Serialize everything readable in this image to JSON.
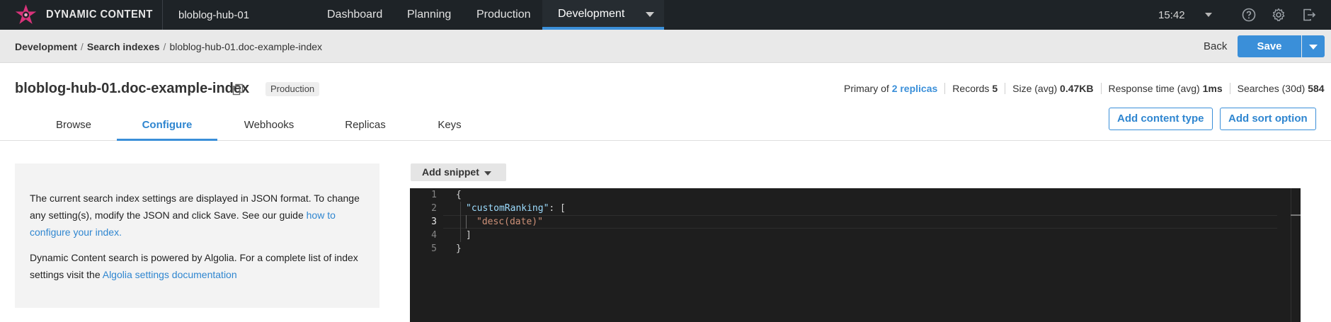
{
  "topbar": {
    "brand": "DYNAMIC CONTENT",
    "hub": "bloblog-hub-01",
    "nav": [
      "Dashboard",
      "Planning",
      "Production",
      "Development"
    ],
    "active_nav": "Development",
    "time": "15:42",
    "icons": [
      "help-icon",
      "gear-icon",
      "logout-icon"
    ]
  },
  "breadcrumb": {
    "items": [
      "Development",
      "Search indexes",
      "bloblog-hub-01.doc-example-index"
    ],
    "back": "Back",
    "save": "Save"
  },
  "index": {
    "name": "bloblog-hub-01.doc-example-index",
    "badge": "Production",
    "stats": {
      "primary_prefix": "Primary of",
      "replicas": "2 replicas",
      "records_label": "Records",
      "records": "5",
      "size_label": "Size (avg)",
      "size": "0.47KB",
      "response_label": "Response time (avg)",
      "response": "1ms",
      "searches_label": "Searches (30d)",
      "searches": "584"
    }
  },
  "tabs": [
    "Browse",
    "Configure",
    "Webhooks",
    "Replicas",
    "Keys"
  ],
  "active_tab": "Configure",
  "actions": {
    "add_content_type": "Add content type",
    "add_sort_option": "Add sort option"
  },
  "info": {
    "p1": "The current search index settings are displayed in JSON format. To change any setting(s), modify the JSON and click Save. See our guide",
    "p1_link": "how to configure your index.",
    "p2": "Dynamic Content search is powered by Algolia. For a complete list of index settings visit the",
    "p2_link": "Algolia settings documentation"
  },
  "editor": {
    "snippet": "Add snippet",
    "lines": [
      {
        "num": "1",
        "text": "{"
      },
      {
        "num": "2",
        "key": "\"customRanking\"",
        "text": ": ["
      },
      {
        "num": "3",
        "value": "\"desc(date)\""
      },
      {
        "num": "4",
        "text": "]"
      },
      {
        "num": "5",
        "text": "}"
      }
    ]
  },
  "colors": {
    "accent": "#3a8fd9",
    "topbar": "#1e2327",
    "editor_bg": "#1e1e1e"
  }
}
